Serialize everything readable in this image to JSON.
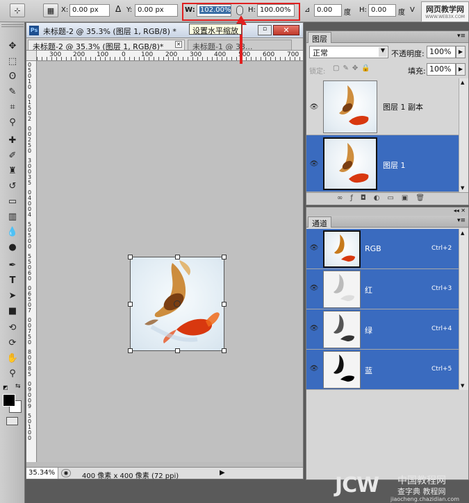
{
  "options_bar": {
    "x_label": "X:",
    "x_value": "0.00 px",
    "delta_label": "Δ",
    "y_label": "Y:",
    "y_value": "0.00 px",
    "w_label": "W:",
    "w_value": "102.00%",
    "h_label": "H:",
    "h_value": "100.00%",
    "angle_value": "0.00",
    "angle_unit": "度",
    "skew_h_label": "H:",
    "skew_h_value": "0.00",
    "skew_unit": "度",
    "skew_v_label": "V"
  },
  "tooltip": "设置水平缩放",
  "document": {
    "title": "未标题-2 @ 35.3% (图层 1, RGB/8) *",
    "ps_badge": "Ps",
    "tabs": [
      {
        "label": "未标题-2 @ 35.3% (图层 1, RGB/8)*"
      },
      {
        "label": "未标题-1 @ 33..."
      }
    ],
    "ruler_h": [
      "300",
      "200",
      "100",
      "0",
      "100",
      "200",
      "300",
      "400",
      "500",
      "600",
      "700"
    ],
    "ruler_v": [
      "0",
      "5",
      "0",
      "1",
      "0",
      "0",
      "1",
      "5",
      "0",
      "2",
      "0",
      "0",
      "2",
      "5",
      "0",
      "3",
      "0",
      "0",
      "3",
      "5",
      "0",
      "4",
      "0",
      "0",
      "4",
      "5",
      "0",
      "5",
      "0",
      "0",
      "5",
      "5",
      "0",
      "6",
      "0",
      "0",
      "6",
      "5",
      "0",
      "7",
      "0",
      "0",
      "7",
      "5",
      "0",
      "8",
      "0",
      "0",
      "8",
      "5",
      "0",
      "9",
      "0",
      "0",
      "9",
      "5",
      "0",
      "1",
      "0",
      "0"
    ],
    "zoom": "35.34%",
    "doc_info": "400 像素 x 400 像素 (72 ppi)"
  },
  "layers_panel": {
    "tab_label": "图层",
    "blend_mode": "正常",
    "opacity_label": "不透明度:",
    "opacity_value": "100%",
    "lock_label": "锁定:",
    "fill_label": "填充:",
    "fill_value": "100%",
    "layers": [
      {
        "name": "图层 1 副本",
        "selected": false
      },
      {
        "name": "图层 1",
        "selected": true
      }
    ]
  },
  "channels_panel": {
    "tab_label": "通道",
    "channels": [
      {
        "name": "RGB",
        "shortcut": "Ctrl+2"
      },
      {
        "name": "红",
        "shortcut": "Ctrl+3"
      },
      {
        "name": "绿",
        "shortcut": "Ctrl+4"
      },
      {
        "name": "蓝",
        "shortcut": "Ctrl+5"
      }
    ]
  },
  "watermarks": {
    "top_right_title": "网页教学网",
    "top_right_url": "WWW.WEB3X.COM",
    "bottom_brand": "JCW",
    "bottom_cn": "中国教程网",
    "bottom_cn2": "查字典 教程网",
    "bottom_url": "jiaocheng.chazidian.com"
  },
  "colors": {
    "selection_blue": "#3a6bbf",
    "annotation_red": "#e02020"
  }
}
